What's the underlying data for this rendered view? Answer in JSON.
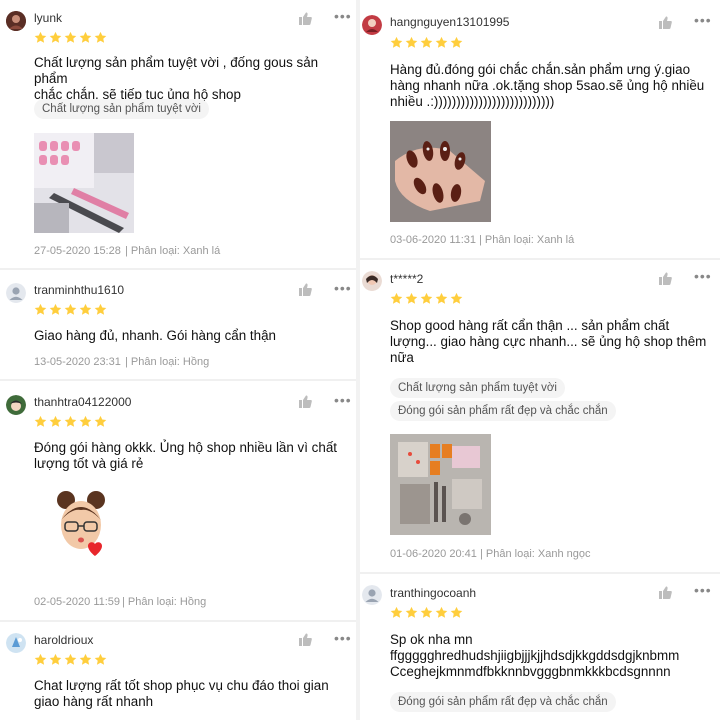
{
  "left_reviews": [
    {
      "username": "lyunk",
      "rating": 5,
      "text": "Chất lượng sản phẩm tuyệt vời , đống gous sản phẩm\nchắc chắn, sẽ tiếp tục ủng hộ shop",
      "tags": [
        "Chất lượng sản phẩm tuyệt vời"
      ],
      "date": "27-05-2020 15:28",
      "variant": "| Phân loại: Xanh lá"
    },
    {
      "username": "tranminhthu1610",
      "rating": 5,
      "text": "Giao hàng đủ, nhanh. Gói hàng cẩn thận",
      "tags": [],
      "date": "13-05-2020 23:31",
      "variant": "| Phân loại: Hồng"
    },
    {
      "username": "thanhtra04122000",
      "rating": 5,
      "text": "Đóng gói hàng okkk. Ủng hộ shop nhiều lần vì chất\nlượng tốt và giá rẻ",
      "tags": [],
      "date": "02-05-2020 11:59",
      "variant": "| Phân loại: Hồng"
    },
    {
      "username": "haroldrioux",
      "rating": 5,
      "text": "Chat lượng rất tốt shop phục vụ chu đáo thoi gian\ngiao hàng rất nhanh",
      "tags": [],
      "date": "",
      "variant": ""
    }
  ],
  "right_reviews": [
    {
      "username": "hangnguyen13101995",
      "rating": 5,
      "text": "Hàng đủ.đóng gói chắc chắn.sản phẩm ưng ý.giao\nhàng nhanh nữa .ok.tặng shop 5sao.sẽ ủng hộ nhiều\nnhiều .:)))))))))))))))))))))))))))",
      "tags": [],
      "date": "03-06-2020 11:31",
      "variant": "| Phân loại: Xanh lá"
    },
    {
      "username": "t*****2",
      "rating": 5,
      "text": "Shop good hàng rất cẩn thận ... sản phẩm chất\nlượng... giao hàng cực nhanh... sẽ ủng hộ shop thêm\nnữa",
      "tags": [
        "Chất lượng sản phẩm tuyệt vời",
        "Đóng gói sản phẩm rất đẹp và chắc chắn"
      ],
      "date": "01-06-2020 20:41",
      "variant": "| Phân loại: Xanh ngọc"
    },
    {
      "username": "tranthingocoanh",
      "rating": 5,
      "text": "Sp ok nha mn\nffggggghredhudshjiigbjjjkjjhdsdjkkgddsdgjknbmm\nCceghejkmnmdfbkknnbvgggbnmkkkbcdsgnnnn",
      "tags": [
        "Đóng gói sản phẩm rất đẹp và chắc chắn"
      ],
      "date": "",
      "variant": ""
    }
  ],
  "icons": {
    "like": "thumbs-up-icon",
    "more": "more-options-icon",
    "star": "star-icon",
    "default_avatar": "user-avatar-icon"
  },
  "colors": {
    "star": "#ffce3d",
    "divider": "#f2f2f2",
    "meta": "#999999",
    "tag_bg": "#f4f4f4"
  }
}
